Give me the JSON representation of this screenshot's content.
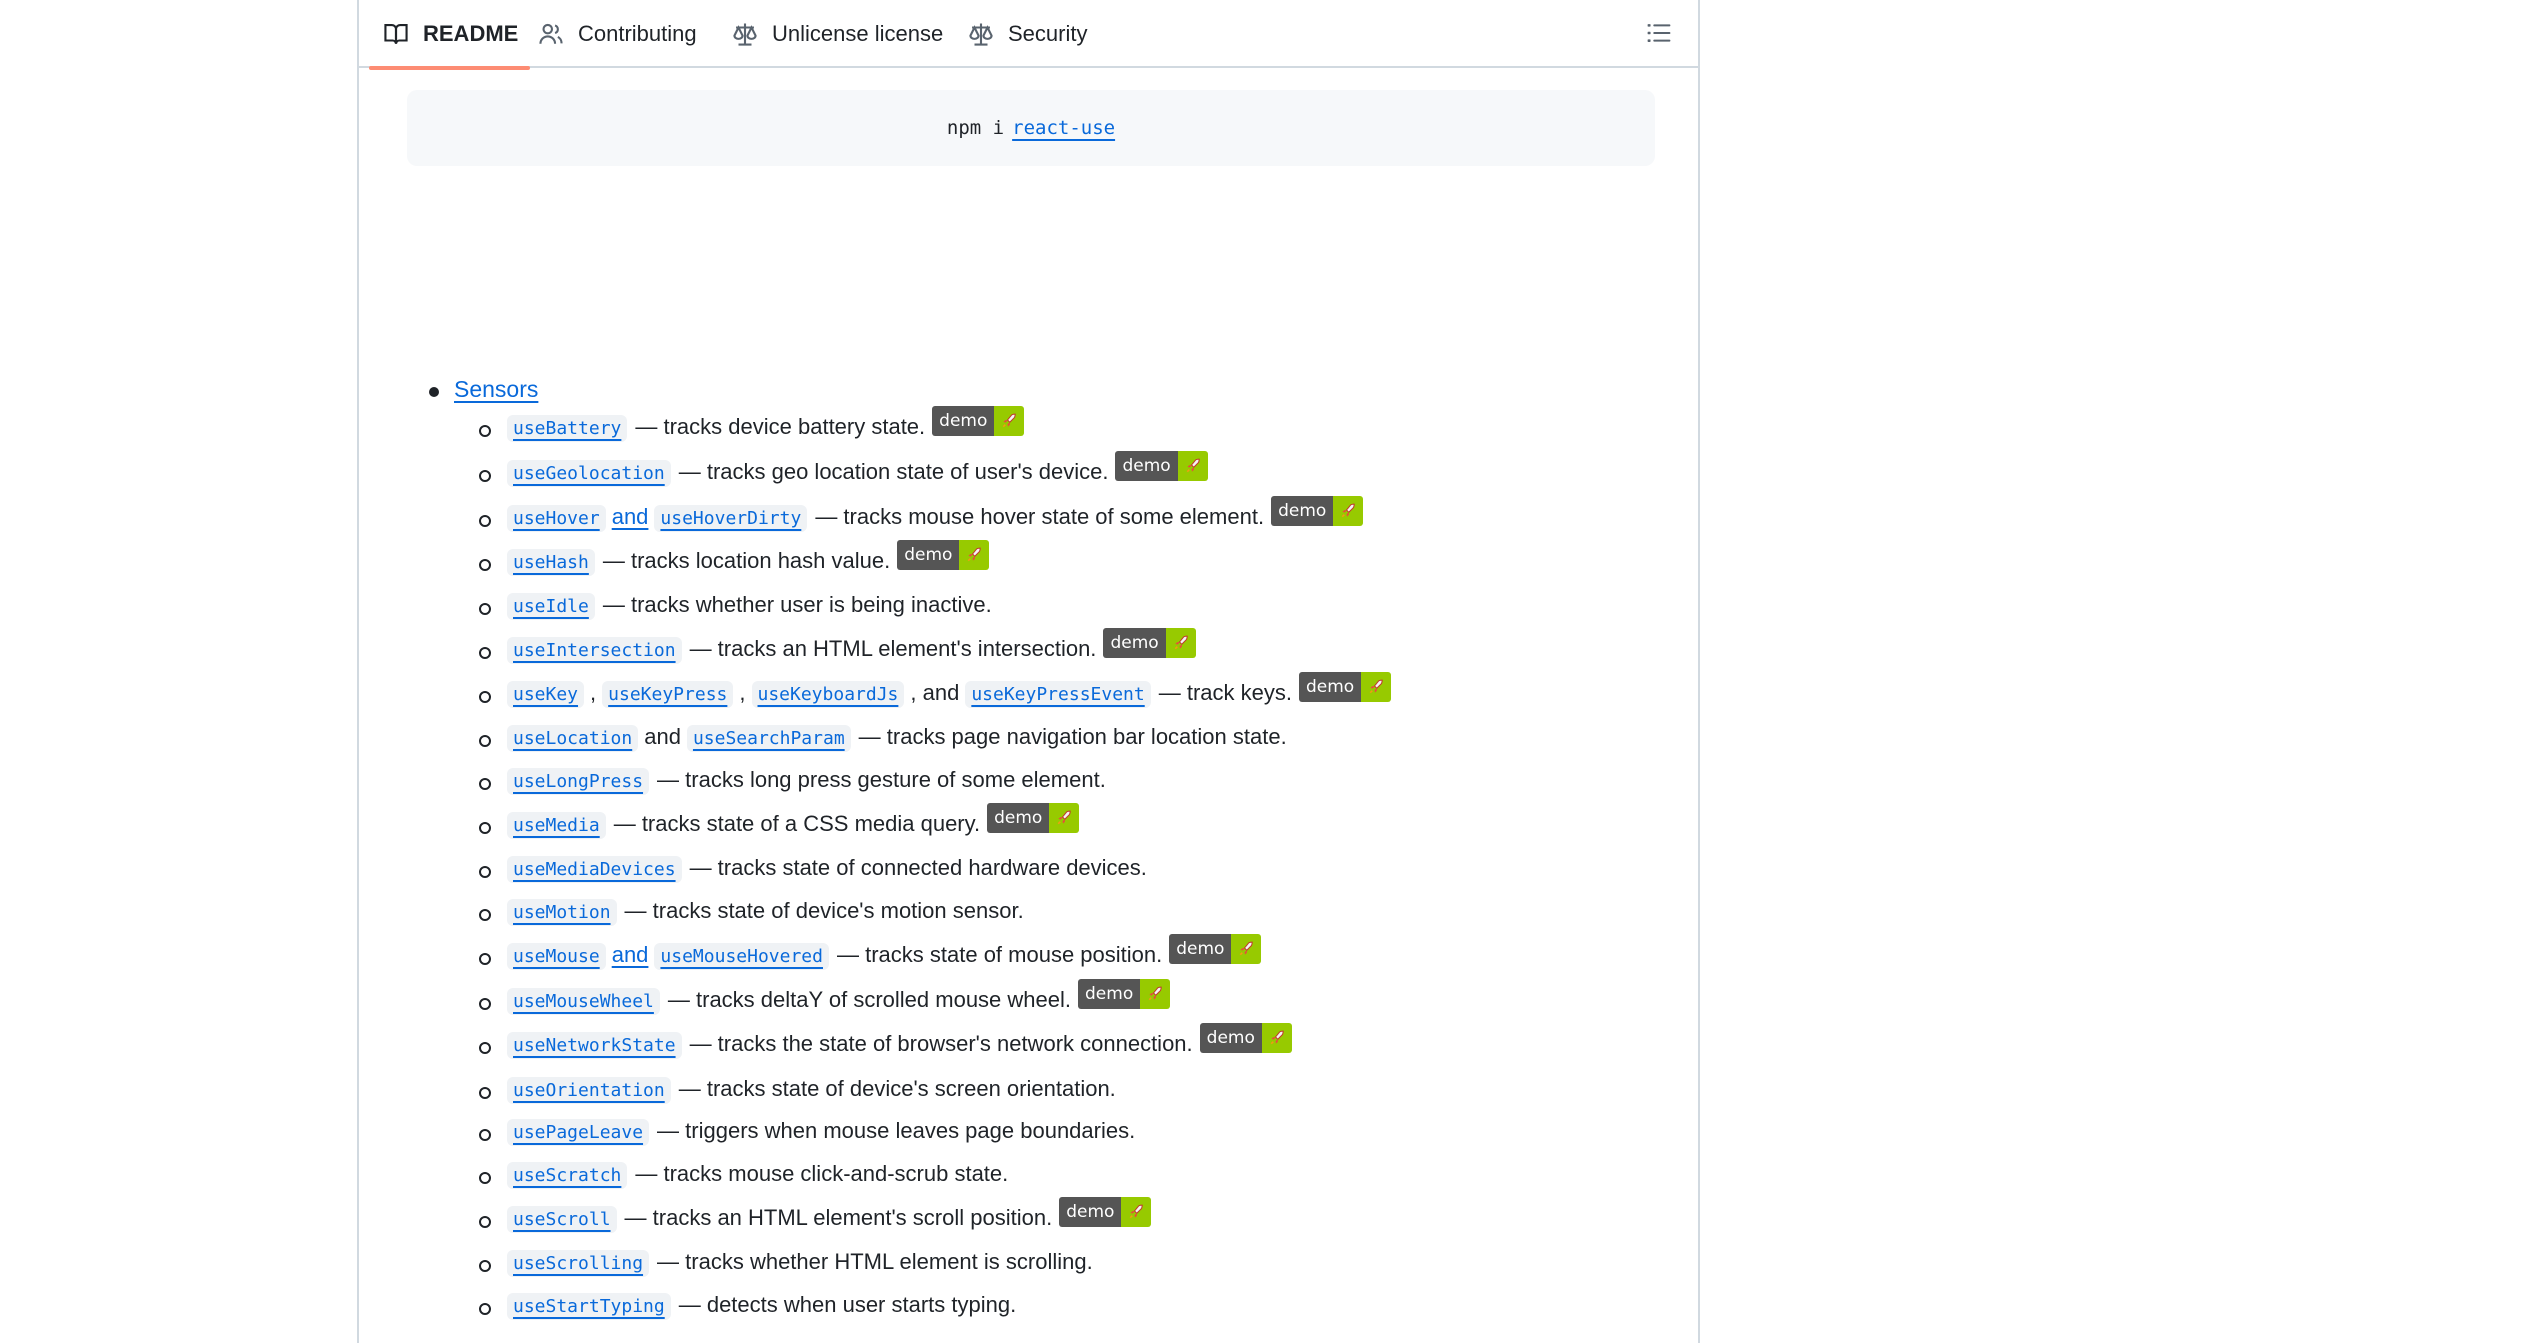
{
  "tabs": [
    {
      "label": "README",
      "icon": "book-icon",
      "active": true
    },
    {
      "label": "Contributing",
      "icon": "people-icon",
      "active": false
    },
    {
      "label": "Unlicense license",
      "icon": "law-icon",
      "active": false
    },
    {
      "label": "Security",
      "icon": "law-icon",
      "active": false
    }
  ],
  "outline_icon": "list-unordered-icon",
  "install": {
    "prefix": "npm i",
    "package": "react-use"
  },
  "section": {
    "title": "Sensors"
  },
  "badge": {
    "label": "demo",
    "icon": "rocket-icon",
    "label_color": "#555555",
    "icon_bg": "#97ca00"
  },
  "colors": {
    "link": "#0969da",
    "tab_indicator": "#fd8c73",
    "code_bg": "#eff2f5",
    "text": "#1f2328"
  },
  "hooks": [
    {
      "parts": [
        {
          "code": "useBattery"
        }
      ],
      "desc": "— tracks device battery state.",
      "demo": true
    },
    {
      "parts": [
        {
          "code": "useGeolocation"
        }
      ],
      "desc": "— tracks geo location state of user's device.",
      "demo": true
    },
    {
      "parts": [
        {
          "code": "useHover"
        },
        {
          "sep": "and",
          "link": true
        },
        {
          "code": "useHoverDirty"
        }
      ],
      "desc": "— tracks mouse hover state of some element.",
      "demo": true
    },
    {
      "parts": [
        {
          "code": "useHash"
        }
      ],
      "desc": "— tracks location hash value.",
      "demo": true
    },
    {
      "parts": [
        {
          "code": "useIdle"
        }
      ],
      "desc": "— tracks whether user is being inactive.",
      "demo": false
    },
    {
      "parts": [
        {
          "code": "useIntersection"
        }
      ],
      "desc": "— tracks an HTML element's intersection.",
      "demo": true
    },
    {
      "parts": [
        {
          "code": "useKey"
        },
        {
          "sep": ","
        },
        {
          "code": "useKeyPress"
        },
        {
          "sep": ","
        },
        {
          "code": "useKeyboardJs"
        },
        {
          "sep": ", and"
        },
        {
          "code": "useKeyPressEvent"
        }
      ],
      "desc": "— track keys.",
      "demo": true
    },
    {
      "parts": [
        {
          "code": "useLocation"
        },
        {
          "sep": "and"
        },
        {
          "code": "useSearchParam"
        }
      ],
      "desc": "— tracks page navigation bar location state.",
      "demo": false
    },
    {
      "parts": [
        {
          "code": "useLongPress"
        }
      ],
      "desc": "— tracks long press gesture of some element.",
      "demo": false
    },
    {
      "parts": [
        {
          "code": "useMedia"
        }
      ],
      "desc": "— tracks state of a CSS media query.",
      "demo": true
    },
    {
      "parts": [
        {
          "code": "useMediaDevices"
        }
      ],
      "desc": "— tracks state of connected hardware devices.",
      "demo": false
    },
    {
      "parts": [
        {
          "code": "useMotion"
        }
      ],
      "desc": "— tracks state of device's motion sensor.",
      "demo": false
    },
    {
      "parts": [
        {
          "code": "useMouse"
        },
        {
          "sep": "and",
          "link": true
        },
        {
          "code": "useMouseHovered"
        }
      ],
      "desc": "— tracks state of mouse position.",
      "demo": true
    },
    {
      "parts": [
        {
          "code": "useMouseWheel"
        }
      ],
      "desc": "— tracks deltaY of scrolled mouse wheel.",
      "demo": true
    },
    {
      "parts": [
        {
          "code": "useNetworkState"
        }
      ],
      "desc": "— tracks the state of browser's network connection.",
      "demo": true
    },
    {
      "parts": [
        {
          "code": "useOrientation"
        }
      ],
      "desc": "— tracks state of device's screen orientation.",
      "demo": false
    },
    {
      "parts": [
        {
          "code": "usePageLeave"
        }
      ],
      "desc": "— triggers when mouse leaves page boundaries.",
      "demo": false
    },
    {
      "parts": [
        {
          "code": "useScratch"
        }
      ],
      "desc": "— tracks mouse click-and-scrub state.",
      "demo": false
    },
    {
      "parts": [
        {
          "code": "useScroll"
        }
      ],
      "desc": "— tracks an HTML element's scroll position.",
      "demo": true
    },
    {
      "parts": [
        {
          "code": "useScrolling"
        }
      ],
      "desc": "— tracks whether HTML element is scrolling.",
      "demo": false
    },
    {
      "parts": [
        {
          "code": "useStartTyping"
        }
      ],
      "desc": "— detects when user starts typing.",
      "demo": false
    }
  ]
}
